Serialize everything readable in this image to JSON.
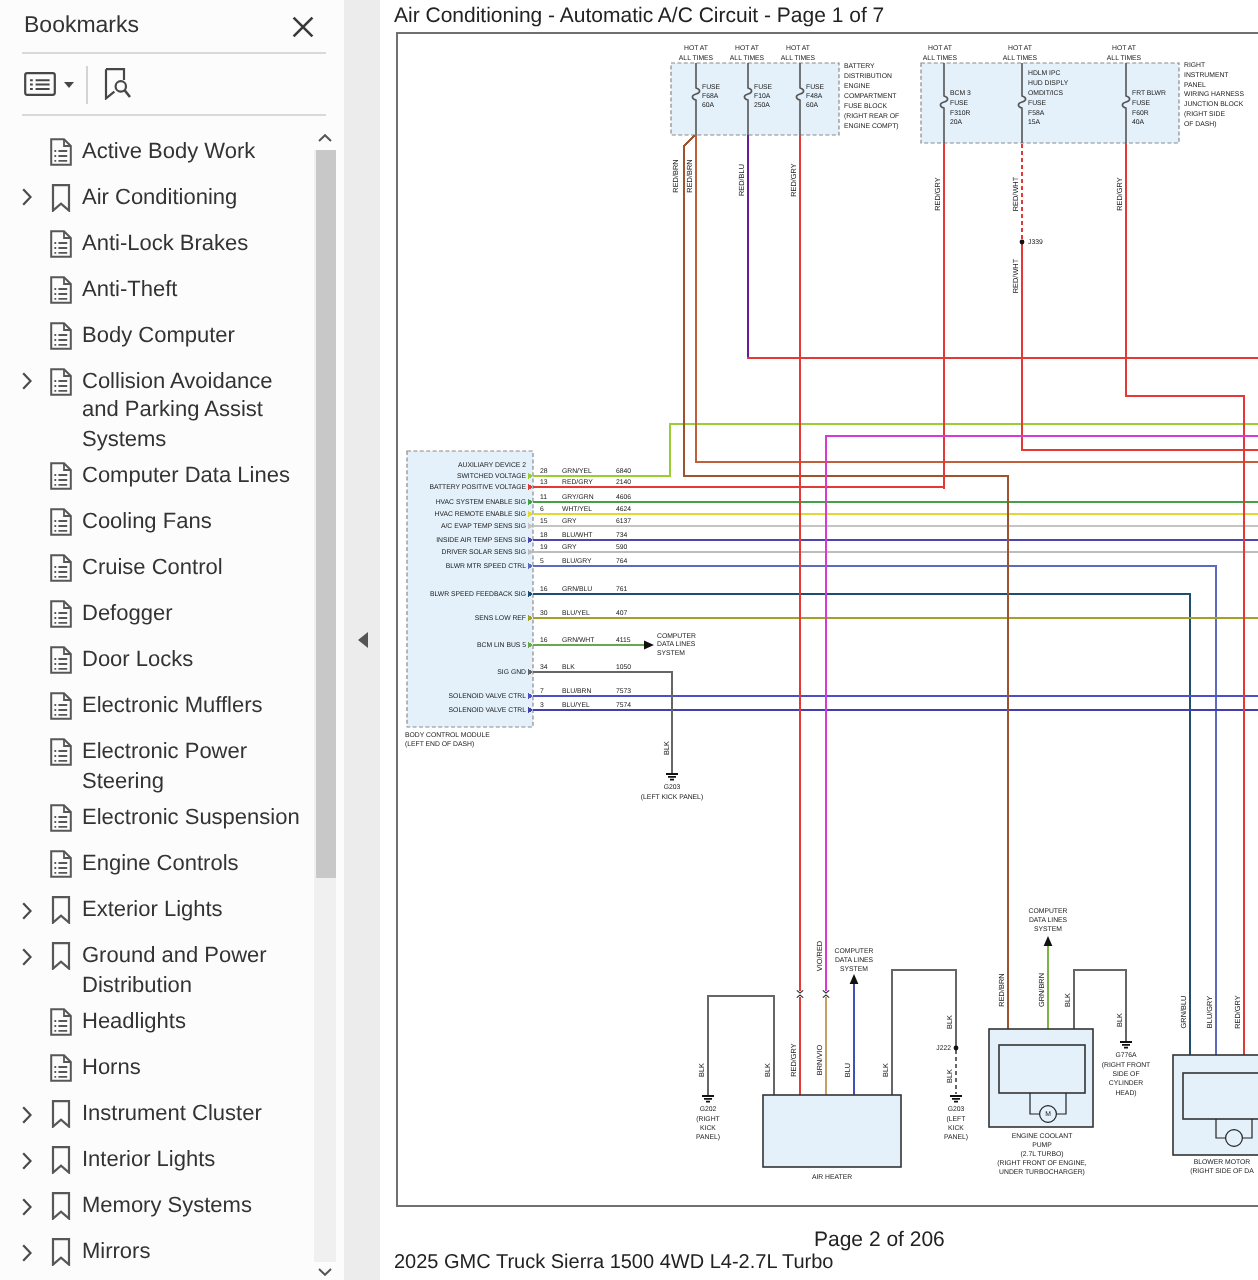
{
  "sidebar": {
    "title": "Bookmarks",
    "items": [
      {
        "label": "Active Body Work",
        "kind": "page",
        "has_children": false
      },
      {
        "label": "Air Conditioning",
        "kind": "bookmark",
        "has_children": true
      },
      {
        "label": "Anti-Lock Brakes",
        "kind": "page",
        "has_children": false
      },
      {
        "label": "Anti-Theft",
        "kind": "page",
        "has_children": false
      },
      {
        "label": "Body Computer",
        "kind": "page",
        "has_children": false
      },
      {
        "label": "Collision Avoidance and Parking Assist Systems",
        "kind": "page",
        "has_children": true
      },
      {
        "label": "Computer Data Lines",
        "kind": "page",
        "has_children": false
      },
      {
        "label": "Cooling Fans",
        "kind": "page",
        "has_children": false
      },
      {
        "label": "Cruise Control",
        "kind": "page",
        "has_children": false
      },
      {
        "label": "Defogger",
        "kind": "page",
        "has_children": false
      },
      {
        "label": "Door Locks",
        "kind": "page",
        "has_children": false
      },
      {
        "label": "Electronic Mufflers",
        "kind": "page",
        "has_children": false
      },
      {
        "label": "Electronic Power Steering",
        "kind": "page",
        "has_children": false
      },
      {
        "label": "Electronic Suspension",
        "kind": "page",
        "has_children": false
      },
      {
        "label": "Engine Controls",
        "kind": "page",
        "has_children": false
      },
      {
        "label": "Exterior Lights",
        "kind": "bookmark",
        "has_children": true
      },
      {
        "label": "Ground and Power Distribution",
        "kind": "bookmark",
        "has_children": true
      },
      {
        "label": "Headlights",
        "kind": "page",
        "has_children": false
      },
      {
        "label": "Horns",
        "kind": "page",
        "has_children": false
      },
      {
        "label": "Instrument Cluster",
        "kind": "bookmark",
        "has_children": true
      },
      {
        "label": "Interior Lights",
        "kind": "bookmark",
        "has_children": true
      },
      {
        "label": "Memory Systems",
        "kind": "bookmark",
        "has_children": true
      },
      {
        "label": "Mirrors",
        "kind": "bookmark",
        "has_children": true
      }
    ]
  },
  "page": {
    "title": "Air Conditioning - Automatic A/C Circuit - Page 1 of 7",
    "diagram": {
      "fuse_blocks": [
        {
          "label": "BATTERY\nDISTRIBUTION\nENGINE\nCOMPARTMENT\nFUSE BLOCK\n(RIGHT REAR OF\nENGINE COMPT)",
          "fuses": [
            {
              "source": "HOT AT\nALL TIMES",
              "label": "FUSE\nF68A\n60A"
            },
            {
              "source": "HOT AT\nALL TIMES",
              "label": "FUSE\nF10A\n250A"
            },
            {
              "source": "HOT AT\nALL TIMES",
              "label": "FUSE\nF48A\n60A"
            }
          ]
        },
        {
          "label": "RIGHT\nINSTRUMENT\nPANEL\nWIRING HARNESS\nJUNCTION BLOCK\n(RIGHT SIDE\nOF DASH)",
          "fuses": [
            {
              "source": "HOT AT\nALL TIMES",
              "label": "BCM 3\nFUSE\nF310R\n20A"
            },
            {
              "source": "HOT AT\nALL TIMES",
              "label": "HDLM IPC\nHUD DISPLY\nOMDIT/ICS\nFUSE\nF58A\n15A"
            },
            {
              "source": "HOT AT\nALL TIMES",
              "label": "FRT BLWR\nFUSE\nF60R\n40A"
            }
          ]
        }
      ],
      "wires": [
        {
          "kind": "solid",
          "label": "RED/BRN",
          "color": "#c0603a"
        },
        {
          "kind": "solid",
          "label": "RED/BRN",
          "color": "#a0522d"
        },
        {
          "kind": "solid",
          "label": "RED/BLU",
          "color": "#6a1b9a"
        },
        {
          "kind": "solid",
          "label": "RED/GRY",
          "color": "#e53935"
        },
        {
          "kind": "solid",
          "label": "RED/GRY",
          "color": "#e53935"
        },
        {
          "kind": "dashed",
          "label": "RED/WHT",
          "color": "#e53935"
        },
        {
          "kind": "solid",
          "label": "RED/WHT",
          "color": "#e53935"
        },
        {
          "kind": "solid",
          "label": "RED/GRY",
          "color": "#e53935"
        },
        {
          "kind": "solid",
          "color": "#e53935"
        },
        {
          "kind": "solid",
          "label": "VIO/RED",
          "color": "#d63ad6"
        },
        {
          "kind": "solid",
          "label": "RED/GRY",
          "color": "#e53935"
        },
        {
          "kind": "solid",
          "label": "BRN/VIO",
          "color": "#c9a063"
        },
        {
          "kind": "solid",
          "label": "BLU",
          "color": "#3f51b5"
        },
        {
          "kind": "solid",
          "label": "BLK",
          "color": "#666666"
        },
        {
          "kind": "solid",
          "label": "BLK",
          "color": "#666666"
        },
        {
          "kind": "solid",
          "label": "BLK",
          "color": "#666666"
        },
        {
          "kind": "solid",
          "label": "BLK",
          "color": "#666666"
        },
        {
          "kind": "dashed",
          "label": "BLK",
          "color": "#666666"
        },
        {
          "kind": "solid",
          "label": "RED/BRN",
          "color": "#a0522d"
        },
        {
          "kind": "solid",
          "label": "GRN/BRN",
          "color": "#7cb342"
        },
        {
          "kind": "solid",
          "label": "BLK",
          "color": "#666666"
        },
        {
          "kind": "solid",
          "label": "BLK",
          "color": "#666666"
        },
        {
          "kind": "solid",
          "label": "GRN/BLU",
          "color": "#1f4e6e"
        },
        {
          "kind": "solid",
          "label": "BLU/GRY",
          "color": "#5c6bc0"
        },
        {
          "kind": "solid",
          "label": "RED/GRY",
          "color": "#e53935"
        },
        {
          "kind": "solid",
          "label": "BLK",
          "color": "#666666"
        }
      ],
      "module": {
        "label": "BODY CONTROL MODULE\n(LEFT END OF DASH)",
        "pins": [
          {
            "kind": "wire",
            "label": "AUXILIARY DEVICE 2\nSWITCHED VOLTAGE",
            "pin": "28",
            "wire": "GRN/YEL",
            "circuit": "6840",
            "color": "#9acd32"
          },
          {
            "kind": "wire",
            "label": "BATTERY POSITIVE VOLTAGE",
            "pin": "13",
            "wire": "RED/GRY",
            "circuit": "2140",
            "color": "#e53935"
          },
          {
            "kind": "wire",
            "label": "HVAC SYSTEM ENABLE SIG",
            "pin": "11",
            "wire": "GRY/GRN",
            "circuit": "4606",
            "color": "#43a047"
          },
          {
            "kind": "wire",
            "label": "HVAC REMOTE ENABLE SIG",
            "pin": "6",
            "wire": "WHT/YEL",
            "circuit": "4624",
            "color": "#e2d835"
          },
          {
            "kind": "wire",
            "label": "A/C EVAP TEMP SENS SIG",
            "pin": "15",
            "wire": "GRY",
            "circuit": "6137",
            "color": "#c4c4c4"
          },
          {
            "kind": "wire",
            "label": "INSIDE AIR TEMP SENS SIG",
            "pin": "18",
            "wire": "BLU/WHT",
            "circuit": "734",
            "color": "#4b45b0"
          },
          {
            "kind": "wire",
            "label": "DRIVER SOLAR SENS SIG",
            "pin": "19",
            "wire": "GRY",
            "circuit": "590",
            "color": "#bdbdbd"
          },
          {
            "kind": "wire",
            "label": "BLWR MTR SPEED CTRL",
            "pin": "5",
            "wire": "BLU/GRY",
            "circuit": "764",
            "color": "#5c6bc0"
          },
          {
            "kind": "wire",
            "label": "BLWR SPEED FEEDBACK SIG",
            "pin": "16",
            "wire": "GRN/BLU",
            "circuit": "761",
            "color": "#1f4e6e"
          },
          {
            "kind": "wire",
            "label": "SENS LOW REF",
            "pin": "30",
            "wire": "BLU/YEL",
            "circuit": "407",
            "color": "#a5a02a"
          },
          {
            "kind": "data_link",
            "label": "BCM LIN BUS 5",
            "pin": "16",
            "wire": "GRN/WHT",
            "circuit": "4115",
            "color": "#6aa84f"
          },
          {
            "kind": "ground",
            "label": "SIG GND",
            "pin": "34",
            "wire": "BLK",
            "circuit": "1050",
            "color": "#666666"
          },
          {
            "kind": "wire",
            "label": "SOLENOID VALVE CTRL",
            "pin": "7",
            "wire": "BLU/BRN",
            "circuit": "7573",
            "color": "#4b4fc8"
          },
          {
            "kind": "wire",
            "label": "SOLENOID VALVE CTRL",
            "pin": "3",
            "wire": "BLU/YEL",
            "circuit": "7574",
            "color": "#3f3fb0"
          }
        ]
      },
      "grounds": [
        {
          "name": "G203",
          "location": "(LEFT KICK PANEL)"
        },
        {
          "name": "G202",
          "location": "(RIGHT\nKICK\nPANEL)"
        },
        {
          "name": "G203",
          "location": "(LEFT\nKICK\nPANEL)"
        },
        {
          "name": "G776A",
          "location": "(RIGHT FRONT\nSIDE OF\nCYLINDER\nHEAD)"
        }
      ],
      "splices": [
        {
          "name": "J339"
        },
        {
          "name": "J222"
        }
      ],
      "links": [
        {
          "text": "COMPUTER\nDATA LINES\nSYSTEM"
        },
        {
          "text": "COMPUTER\nDATA LINES\nSYSTEM"
        },
        {
          "text": "COMPUTER\nDATA LINES\nSYSTEM"
        }
      ],
      "components": [
        {
          "kind": "box",
          "label": "AIR HEATER"
        },
        {
          "kind": "motor",
          "label": "ENGINE COOLANT\nPUMP\n(2.7L TURBO)\n(RIGHT FRONT OF ENGINE,\nUNDER TURBOCHARGER)",
          "symbol": "M"
        },
        {
          "kind": "motor",
          "label": "BLOWER MOTOR\n(RIGHT SIDE OF DA"
        }
      ]
    },
    "page_number": "Page 2 of 206",
    "footer": "2025 GMC Truck Sierra 1500 4WD L4-2.7L Turbo"
  }
}
